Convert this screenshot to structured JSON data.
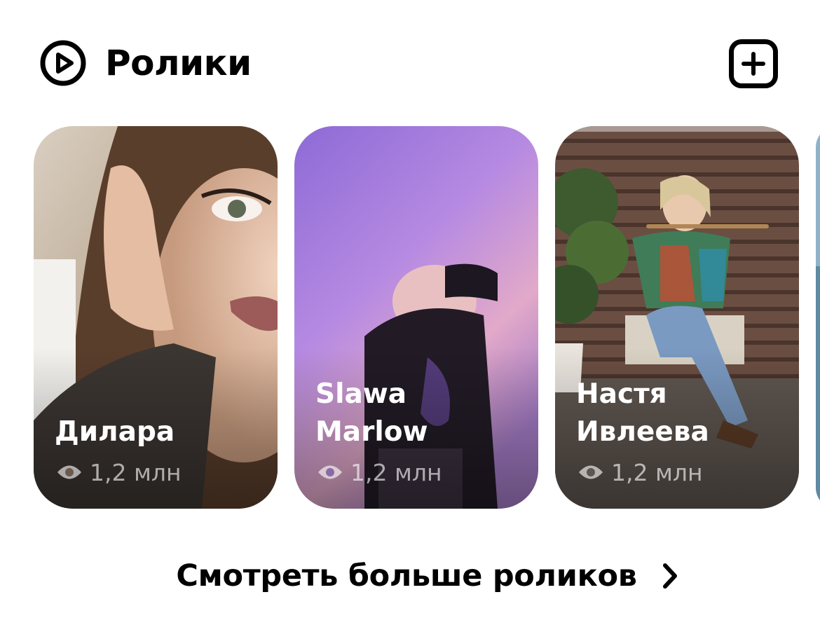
{
  "header": {
    "title": "Ролики",
    "icon": "play-circle-icon",
    "add_icon": "plus-square-icon"
  },
  "cards": [
    {
      "name": "Дилара",
      "views": "1,2 млн"
    },
    {
      "name": "Slawa Marlow",
      "views": "1,2 млн"
    },
    {
      "name": "Настя\nИвлеева",
      "views": "1,2 млн"
    }
  ],
  "footer": {
    "more_label": "Смотреть больше роликов",
    "more_icon": "chevron-right-icon"
  },
  "colors": {
    "text": "#000000",
    "overlay_text": "#ffffff",
    "card2_accent": "#9a6fe0"
  }
}
